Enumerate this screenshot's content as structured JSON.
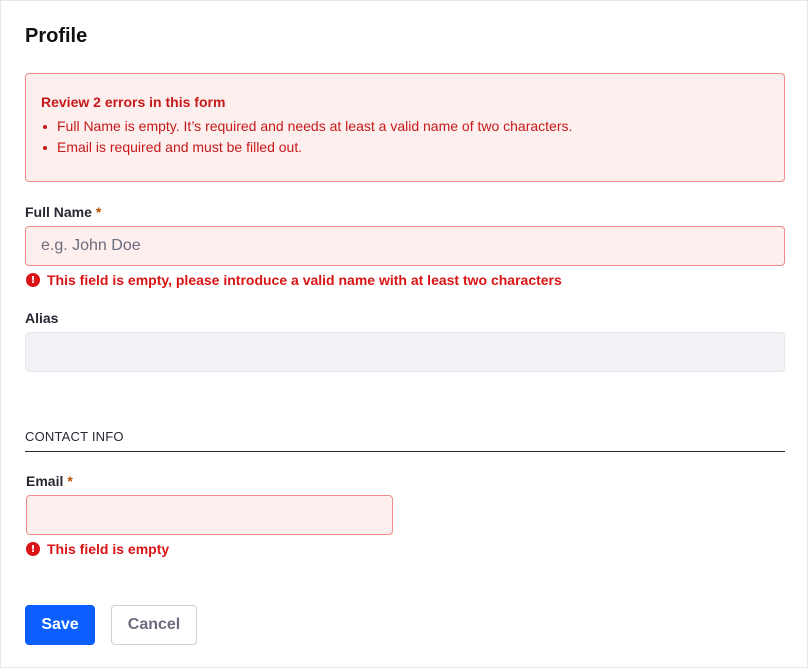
{
  "page": {
    "title": "Profile"
  },
  "alert": {
    "title": "Review 2 errors in this form",
    "items": [
      "Full Name is empty. It’s required and needs at least a valid name of two characters.",
      "Email is required and must be filled out."
    ]
  },
  "fields": {
    "full_name": {
      "label": "Full Name",
      "required_mark": "*",
      "placeholder": "e.g. John Doe",
      "value": "",
      "error": "This field is empty, please introduce a valid name with at least two characters"
    },
    "alias": {
      "label": "Alias",
      "value": ""
    },
    "email": {
      "label": "Email",
      "required_mark": "*",
      "value": "",
      "error": "This field is empty"
    }
  },
  "section": {
    "contact_title": "CONTACT INFO"
  },
  "actions": {
    "save_label": "Save",
    "cancel_label": "Cancel"
  },
  "icons": {
    "error_glyph": "!"
  },
  "colors": {
    "primary": "#0b5fff",
    "error": "#da1414",
    "error_bg": "#feefef",
    "error_border": "#f48989",
    "required": "#b95000"
  }
}
